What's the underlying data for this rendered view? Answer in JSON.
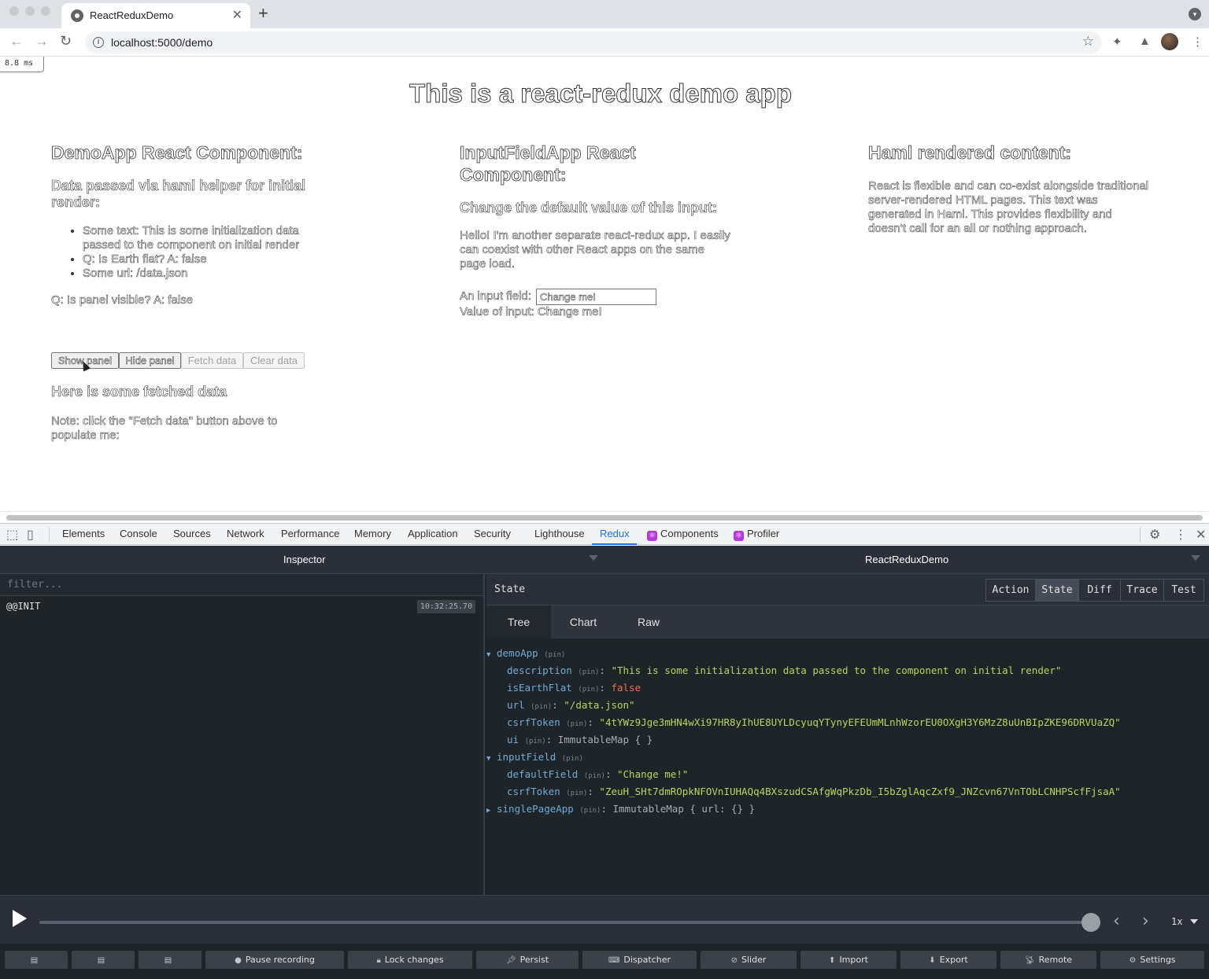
{
  "browser": {
    "tab_title": "ReactReduxDemo",
    "url": "localhost:5000/demo",
    "new_tab": "+",
    "close": "✕"
  },
  "page": {
    "timing": "8.8 ms",
    "title": "This is a react-redux demo app",
    "demo": {
      "heading": "DemoApp React Component:",
      "subheading": "Data passed via haml helper for initial render:",
      "items": [
        "Some text: This is some initialization data passed to the component on initial render",
        "Q: Is Earth flat? A: false",
        "Some url: /data.json"
      ],
      "panel_visible": "Q: Is panel visible? A: false",
      "buttons": [
        "Show panel",
        "Hide panel",
        "Fetch data",
        "Clear data"
      ],
      "fetched_heading": "Here is some fetched data",
      "note": "Note: click the \"Fetch data\" button above to populate me:"
    },
    "input_app": {
      "heading": "InputFieldApp React Component:",
      "subheading": "Change the default value of this input:",
      "description": "Hello! I'm another separate react-redux app. I easily can coexist with other React apps on the same page load.",
      "label": "An input field:",
      "value": "Change me!",
      "value_line": "Value of input: Change me!"
    },
    "haml": {
      "heading": "Haml rendered content:",
      "text": "React is flexible and can co-exist alongside traditional server-rendered HTML pages. This text was generated in Haml. This provides flexibility and doesn't call for an all or nothing approach."
    }
  },
  "devtools": {
    "tabs": [
      "Elements",
      "Console",
      "Sources",
      "Network",
      "Performance",
      "Memory",
      "Application",
      "Security",
      "Lighthouse",
      "Redux",
      "Components",
      "Profiler"
    ],
    "active_tab": "Redux"
  },
  "redux": {
    "left_title": "Inspector",
    "right_title": "ReactReduxDemo",
    "filter_placeholder": "filter...",
    "actions": [
      {
        "name": "@@INIT",
        "time": "10:32:25.70"
      }
    ],
    "state_label": "State",
    "modes": [
      "Action",
      "State",
      "Diff",
      "Trace",
      "Test"
    ],
    "active_mode": "State",
    "subtabs": [
      "Tree",
      "Chart",
      "Raw"
    ],
    "pin": "(pin)",
    "tree": {
      "demoApp": "demoApp",
      "description_key": "description",
      "description_val": "\"This is some initialization data passed to the component on initial render\"",
      "isEarthFlat_key": "isEarthFlat",
      "isEarthFlat_val": "false",
      "url_key": "url",
      "url_val": "\"/data.json\"",
      "csrf1_key": "csrfToken",
      "csrf1_val": "\"4tYWz9Jge3mHN4wXi97HR8yIhUE8UYLDcyuqYTynyEFEUmMLnhWzorEU0OXgH3Y6MzZ8uUnBIpZKE96DRVUaZQ\"",
      "ui_key": "ui",
      "ui_val": "ImmutableMap { }",
      "inputField": "inputField",
      "defaultField_key": "defaultField",
      "defaultField_val": "\"Change me!\"",
      "csrf2_key": "csrfToken",
      "csrf2_val": "\"ZeuH_SHt7dmROpkNFOVnIUHAQq4BXszudCSAfgWqPkzDb_I5bZglAqcZxf9_JNZcvn67VnTObLCNHPScfFjsaA\"",
      "singlePageApp": "singlePageApp",
      "singlePageApp_val": "ImmutableMap { url: {} }"
    },
    "speed": "1x",
    "footer_buttons": [
      "Pause recording",
      "Lock changes",
      "Persist",
      "Dispatcher",
      "Slider",
      "Import",
      "Export",
      "Remote",
      "Settings"
    ]
  }
}
